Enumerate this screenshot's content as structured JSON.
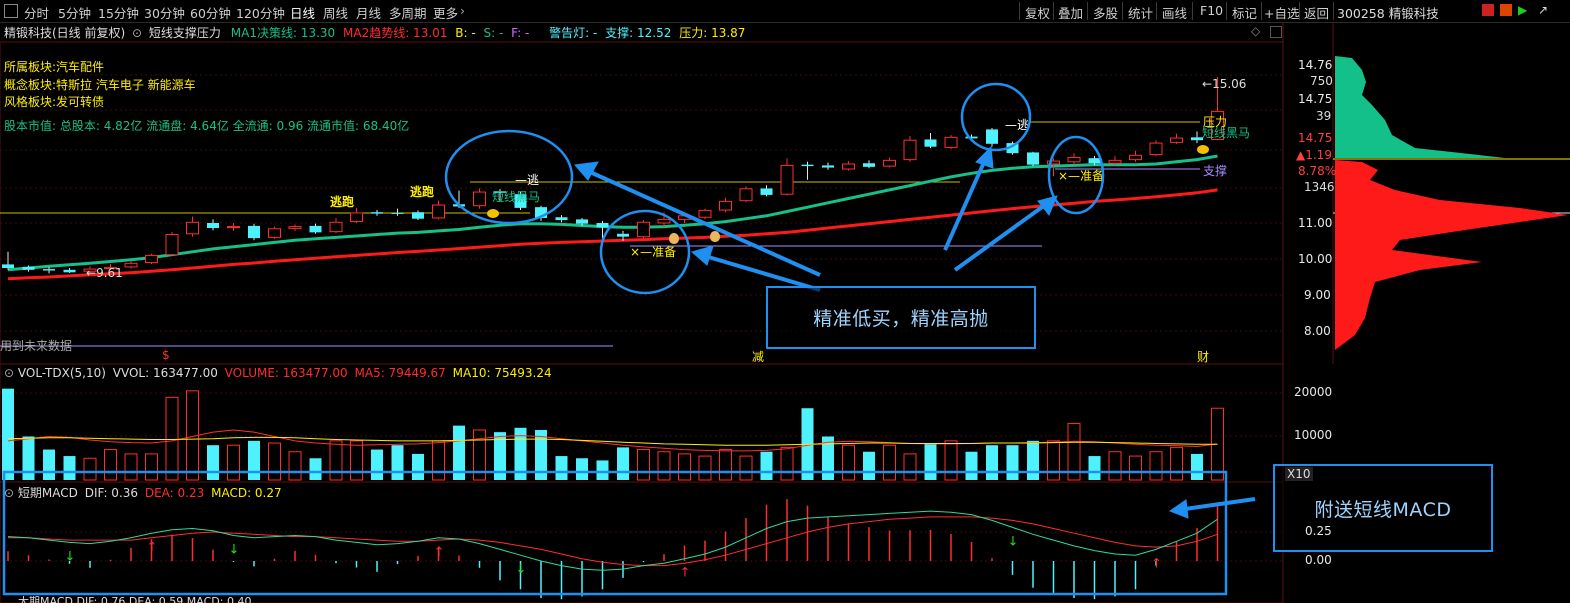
{
  "toolbar": {
    "periods": [
      "分时",
      "5分钟",
      "15分钟",
      "30分钟",
      "60分钟",
      "120分钟",
      "日线",
      "周线",
      "月线",
      "多周期",
      "更多"
    ],
    "active_period": "日线",
    "right_buttons": [
      "复权",
      "叠加",
      "多股",
      "统计",
      "画线",
      "F10",
      "标记",
      "+自选",
      "返回"
    ],
    "stock_title": "300258 精锻科技"
  },
  "chart_header": {
    "stock": "精锻科技(日线 前复权)",
    "indicator_name": "短线支撑压力",
    "ma1": "MA1决策线: 13.30",
    "ma2": "MA2趋势线: 13.01",
    "b": "B: -",
    "s": "S: -",
    "f": "F: -",
    "warning": "警告灯: -",
    "support": "支撑: 12.52",
    "pressure": "压力: 13.87"
  },
  "info": {
    "sector": "所属板块:",
    "sector_value": "汽车配件",
    "concept": "概念板块:",
    "concept_value": "特斯拉 汽车电子 新能源车",
    "style": "风格板块:",
    "style_value": "发可转债",
    "equity": "股本市值: 总股本: 4.82亿 流通盘: 4.64亿 全流通: 0.96 流通市值: 68.40亿"
  },
  "annotations": {
    "escape1": "逃跑",
    "escape2": "逃跑",
    "escape3": "逃",
    "escape4": "逃",
    "prepare1": "准备",
    "prepare2": "准备",
    "dark_horse1": "短线黑马",
    "dark_horse2": "短线黑马",
    "pressure_tag": "压力",
    "support_tag": "支撑",
    "low_price": "9.61",
    "high_price": "15.06",
    "future_data": "用到未来数据",
    "event_s": "$",
    "event_reduce": "减",
    "event_fin": "财"
  },
  "price_axis": [
    "14.76",
    "14.75",
    "14.75",
    "11.00",
    "10.00",
    "9.00",
    "8.00"
  ],
  "price_axis_extra": [
    "750",
    "39",
    "▲1.19",
    "8.78%",
    "1346"
  ],
  "volume_header": {
    "name": "VOL-TDX(5,10)",
    "vvol": "VVOL: 163477.00",
    "volume": "VOLUME: 163477.00",
    "ma5": "MA5: 79449.67",
    "ma10": "MA10: 75493.24"
  },
  "volume_axis": [
    "20000",
    "10000"
  ],
  "volume_unit": "X10",
  "macd_header": {
    "name": "短期MACD",
    "dif": "DIF: 0.36",
    "dea": "DEA: 0.23",
    "macd": "MACD: 0.27"
  },
  "macd_axis": [
    "0.25",
    "0.00"
  ],
  "macd_footer": "大期MACD DIF: 0.76 DEA: 0.59 MACD: 0.40",
  "callouts": {
    "main": "精准低买，精准高抛",
    "macd": "附送短线MACD"
  },
  "colors": {
    "up": "#ff2d2d",
    "down": "#4ef2ff",
    "ma_green": "#16c08a",
    "ma_red": "#ff1a1a",
    "callout": "#1f8ff0",
    "yellow": "#ffee00"
  },
  "chart_data": {
    "type": "candlestick",
    "candles": [
      {
        "o": 9.85,
        "c": 9.75,
        "h": 10.2,
        "l": 9.7
      },
      {
        "o": 9.78,
        "c": 9.7,
        "h": 9.82,
        "l": 9.65
      },
      {
        "o": 9.72,
        "c": 9.68,
        "h": 9.78,
        "l": 9.6
      },
      {
        "o": 9.7,
        "c": 9.63,
        "h": 9.75,
        "l": 9.61
      },
      {
        "o": 9.66,
        "c": 9.72,
        "h": 9.8,
        "l": 9.62
      },
      {
        "o": 9.74,
        "c": 9.76,
        "h": 9.86,
        "l": 9.7
      },
      {
        "o": 9.78,
        "c": 9.88,
        "h": 9.95,
        "l": 9.74
      },
      {
        "o": 9.9,
        "c": 10.1,
        "h": 10.15,
        "l": 9.86
      },
      {
        "o": 10.12,
        "c": 10.68,
        "h": 10.75,
        "l": 10.1
      },
      {
        "o": 10.7,
        "c": 11.02,
        "h": 11.18,
        "l": 10.62
      },
      {
        "o": 11.0,
        "c": 10.86,
        "h": 11.1,
        "l": 10.8
      },
      {
        "o": 10.88,
        "c": 10.9,
        "h": 11.0,
        "l": 10.78
      },
      {
        "o": 10.92,
        "c": 10.58,
        "h": 10.98,
        "l": 10.52
      },
      {
        "o": 10.6,
        "c": 10.84,
        "h": 10.9,
        "l": 10.56
      },
      {
        "o": 10.85,
        "c": 10.9,
        "h": 10.96,
        "l": 10.78
      },
      {
        "o": 10.92,
        "c": 10.74,
        "h": 10.98,
        "l": 10.7
      },
      {
        "o": 10.76,
        "c": 11.02,
        "h": 11.14,
        "l": 10.72
      },
      {
        "o": 11.04,
        "c": 11.28,
        "h": 11.42,
        "l": 11.0
      },
      {
        "o": 11.3,
        "c": 11.26,
        "h": 11.36,
        "l": 11.2
      },
      {
        "o": 11.28,
        "c": 11.27,
        "h": 11.4,
        "l": 11.2
      },
      {
        "o": 11.3,
        "c": 11.12,
        "h": 11.35,
        "l": 11.08
      },
      {
        "o": 11.14,
        "c": 11.5,
        "h": 11.62,
        "l": 11.1
      },
      {
        "o": 11.52,
        "c": 11.46,
        "h": 11.9,
        "l": 11.42
      },
      {
        "o": 11.48,
        "c": 11.86,
        "h": 11.96,
        "l": 11.4
      },
      {
        "o": 11.88,
        "c": 11.84,
        "h": 11.94,
        "l": 11.62
      },
      {
        "o": 11.8,
        "c": 11.42,
        "h": 11.86,
        "l": 11.36
      },
      {
        "o": 11.44,
        "c": 11.14,
        "h": 11.48,
        "l": 11.06
      },
      {
        "o": 11.16,
        "c": 11.08,
        "h": 11.22,
        "l": 11.02
      },
      {
        "o": 11.1,
        "c": 10.98,
        "h": 11.14,
        "l": 10.92
      },
      {
        "o": 11.0,
        "c": 10.88,
        "h": 11.06,
        "l": 10.56
      },
      {
        "o": 10.7,
        "c": 10.62,
        "h": 10.78,
        "l": 10.5
      },
      {
        "o": 10.62,
        "c": 11.02,
        "h": 11.08,
        "l": 10.58
      },
      {
        "o": 11.0,
        "c": 11.1,
        "h": 11.3,
        "l": 10.9
      },
      {
        "o": 11.1,
        "c": 11.2,
        "h": 11.28,
        "l": 11.0
      },
      {
        "o": 11.16,
        "c": 11.35,
        "h": 11.4,
        "l": 11.1
      },
      {
        "o": 11.36,
        "c": 11.6,
        "h": 11.7,
        "l": 11.3
      },
      {
        "o": 11.62,
        "c": 11.95,
        "h": 12.02,
        "l": 11.58
      },
      {
        "o": 11.96,
        "c": 11.78,
        "h": 12.05,
        "l": 11.74
      },
      {
        "o": 11.8,
        "c": 12.6,
        "h": 12.8,
        "l": 11.76
      },
      {
        "o": 12.62,
        "c": 12.58,
        "h": 12.7,
        "l": 12.2
      },
      {
        "o": 12.6,
        "c": 12.54,
        "h": 12.68,
        "l": 12.48
      },
      {
        "o": 12.5,
        "c": 12.64,
        "h": 12.72,
        "l": 12.46
      },
      {
        "o": 12.66,
        "c": 12.56,
        "h": 12.74,
        "l": 12.52
      },
      {
        "o": 12.58,
        "c": 12.74,
        "h": 12.82,
        "l": 12.54
      },
      {
        "o": 12.76,
        "c": 13.3,
        "h": 13.42,
        "l": 12.7
      },
      {
        "o": 13.32,
        "c": 13.12,
        "h": 13.5,
        "l": 13.08
      },
      {
        "o": 13.1,
        "c": 13.38,
        "h": 13.44,
        "l": 13.06
      },
      {
        "o": 13.4,
        "c": 13.35,
        "h": 13.46,
        "l": 13.3
      },
      {
        "o": 13.6,
        "c": 13.2,
        "h": 13.64,
        "l": 13.12
      },
      {
        "o": 13.22,
        "c": 12.94,
        "h": 13.26,
        "l": 12.9
      },
      {
        "o": 12.96,
        "c": 12.62,
        "h": 12.98,
        "l": 12.58
      },
      {
        "o": 12.64,
        "c": 12.72,
        "h": 12.8,
        "l": 12.3
      },
      {
        "o": 12.7,
        "c": 12.82,
        "h": 12.94,
        "l": 12.62
      },
      {
        "o": 12.8,
        "c": 12.66,
        "h": 12.86,
        "l": 12.6
      },
      {
        "o": 12.66,
        "c": 12.74,
        "h": 12.86,
        "l": 12.6
      },
      {
        "o": 12.76,
        "c": 12.88,
        "h": 13.0,
        "l": 12.7
      },
      {
        "o": 12.9,
        "c": 13.22,
        "h": 13.3,
        "l": 12.86
      },
      {
        "o": 13.24,
        "c": 13.36,
        "h": 13.48,
        "l": 13.2
      },
      {
        "o": 13.38,
        "c": 13.3,
        "h": 13.54,
        "l": 13.22
      },
      {
        "o": 13.32,
        "c": 14.1,
        "h": 15.06,
        "l": 13.3
      }
    ],
    "ma1": [
      9.7,
      9.75,
      9.8,
      9.84,
      9.88,
      9.93,
      9.98,
      10.04,
      10.12,
      10.2,
      10.28,
      10.34,
      10.4,
      10.46,
      10.52,
      10.56,
      10.6,
      10.64,
      10.68,
      10.72,
      10.74,
      10.78,
      10.82,
      10.88,
      10.94,
      10.98,
      10.98,
      10.96,
      10.93,
      10.9,
      10.88,
      10.88,
      10.9,
      10.94,
      10.98,
      11.04,
      11.12,
      11.2,
      11.32,
      11.44,
      11.56,
      11.68,
      11.8,
      11.92,
      12.04,
      12.16,
      12.28,
      12.38,
      12.46,
      12.52,
      12.56,
      12.58,
      12.6,
      12.62,
      12.62,
      12.62,
      12.64,
      12.7,
      12.76,
      12.86
    ],
    "ma2": [
      9.45,
      9.48,
      9.5,
      9.53,
      9.56,
      9.59,
      9.62,
      9.66,
      9.7,
      9.75,
      9.8,
      9.85,
      9.89,
      9.94,
      9.98,
      10.02,
      10.06,
      10.1,
      10.14,
      10.18,
      10.21,
      10.25,
      10.29,
      10.33,
      10.37,
      10.41,
      10.44,
      10.46,
      10.48,
      10.5,
      10.52,
      10.54,
      10.56,
      10.58,
      10.6,
      10.63,
      10.66,
      10.7,
      10.74,
      10.8,
      10.86,
      10.92,
      10.98,
      11.04,
      11.1,
      11.16,
      11.22,
      11.28,
      11.34,
      11.4,
      11.45,
      11.5,
      11.55,
      11.6,
      11.64,
      11.68,
      11.73,
      11.78,
      11.84,
      11.92
    ],
    "volume": [
      21000,
      10000,
      7000,
      5500,
      5000,
      7000,
      6000,
      6000,
      19000,
      20500,
      8000,
      8000,
      9000,
      8500,
      6500,
      5000,
      9000,
      9000,
      7000,
      8000,
      6000,
      9000,
      12500,
      11500,
      11000,
      12000,
      11500,
      5500,
      5000,
      4500,
      7500,
      7000,
      6500,
      6000,
      5500,
      7000,
      5500,
      6500,
      7500,
      16500,
      10000,
      8000,
      6500,
      8000,
      6000,
      8500,
      9000,
      6500,
      8000,
      8000,
      9000,
      9000,
      13000,
      5500,
      6500,
      5500,
      6500,
      7500,
      6000,
      16500
    ],
    "vol_ma5": [
      9000,
      9500,
      10000,
      9800,
      9200,
      8800,
      8600,
      8500,
      9000,
      10000,
      11000,
      11500,
      11000,
      10000,
      9000,
      8500,
      8200,
      8000,
      8100,
      8200,
      8300,
      8600,
      9000,
      9500,
      10000,
      10200,
      10000,
      9500,
      9000,
      8500,
      8000,
      7600,
      7300,
      7000,
      6800,
      6700,
      6700,
      6800,
      7200,
      8000,
      8700,
      8900,
      8800,
      8600,
      8400,
      8300,
      8300,
      8400,
      8500,
      8500,
      8600,
      8700,
      8900,
      8800,
      8500,
      8200,
      8000,
      7900,
      7700,
      8300
    ],
    "vol_ma10": [
      9500,
      9600,
      9700,
      9700,
      9600,
      9500,
      9400,
      9300,
      9300,
      9400,
      9500,
      9700,
      9800,
      9800,
      9700,
      9500,
      9300,
      9200,
      9100,
      9000,
      9000,
      9000,
      9100,
      9200,
      9300,
      9400,
      9400,
      9300,
      9100,
      8900,
      8700,
      8500,
      8300,
      8200,
      8100,
      8000,
      8000,
      8000,
      8100,
      8200,
      8300,
      8400,
      8500,
      8500,
      8400,
      8400,
      8400,
      8400,
      8500,
      8500,
      8500,
      8600,
      8700,
      8700,
      8600,
      8500,
      8400,
      8300,
      8200,
      8200
    ],
    "macd_dif": [
      0.21,
      0.2,
      0.18,
      0.16,
      0.15,
      0.17,
      0.2,
      0.24,
      0.27,
      0.28,
      0.26,
      0.22,
      0.2,
      0.21,
      0.22,
      0.21,
      0.18,
      0.16,
      0.14,
      0.15,
      0.17,
      0.2,
      0.19,
      0.15,
      0.1,
      0.05,
      0.0,
      -0.04,
      -0.07,
      -0.08,
      -0.07,
      -0.04,
      -0.02,
      0.02,
      0.06,
      0.12,
      0.2,
      0.28,
      0.34,
      0.37,
      0.38,
      0.39,
      0.4,
      0.41,
      0.42,
      0.43,
      0.42,
      0.4,
      0.35,
      0.29,
      0.23,
      0.18,
      0.13,
      0.09,
      0.06,
      0.05,
      0.1,
      0.17,
      0.24,
      0.36
    ],
    "macd_dea": [
      0.2,
      0.2,
      0.19,
      0.18,
      0.18,
      0.18,
      0.18,
      0.2,
      0.22,
      0.24,
      0.25,
      0.24,
      0.23,
      0.22,
      0.21,
      0.21,
      0.2,
      0.19,
      0.18,
      0.17,
      0.17,
      0.18,
      0.19,
      0.18,
      0.16,
      0.13,
      0.1,
      0.06,
      0.02,
      -0.01,
      -0.03,
      -0.04,
      -0.04,
      -0.02,
      0.01,
      0.05,
      0.1,
      0.15,
      0.2,
      0.25,
      0.29,
      0.32,
      0.34,
      0.36,
      0.37,
      0.38,
      0.38,
      0.38,
      0.37,
      0.35,
      0.32,
      0.28,
      0.24,
      0.2,
      0.16,
      0.13,
      0.12,
      0.13,
      0.17,
      0.23
    ]
  }
}
